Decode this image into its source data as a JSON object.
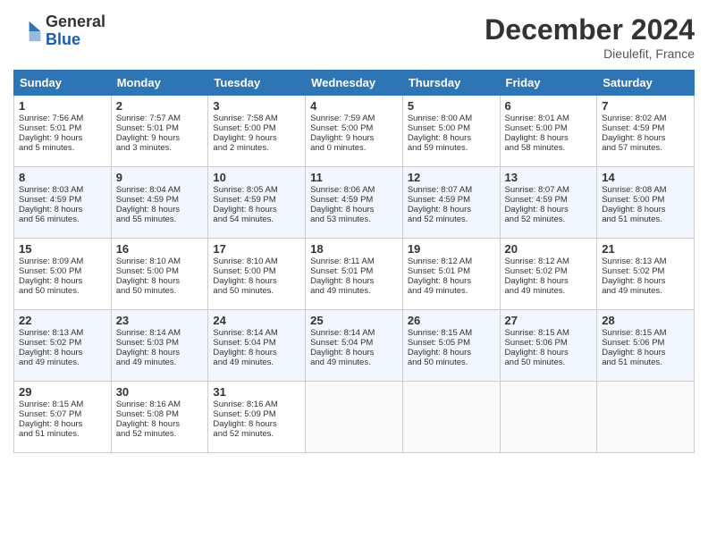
{
  "logo": {
    "line1": "General",
    "line2": "Blue"
  },
  "title": "December 2024",
  "subtitle": "Dieulefit, France",
  "weekdays": [
    "Sunday",
    "Monday",
    "Tuesday",
    "Wednesday",
    "Thursday",
    "Friday",
    "Saturday"
  ],
  "weeks": [
    [
      {
        "day": "1",
        "lines": [
          "Sunrise: 7:56 AM",
          "Sunset: 5:01 PM",
          "Daylight: 9 hours",
          "and 5 minutes."
        ]
      },
      {
        "day": "2",
        "lines": [
          "Sunrise: 7:57 AM",
          "Sunset: 5:01 PM",
          "Daylight: 9 hours",
          "and 3 minutes."
        ]
      },
      {
        "day": "3",
        "lines": [
          "Sunrise: 7:58 AM",
          "Sunset: 5:00 PM",
          "Daylight: 9 hours",
          "and 2 minutes."
        ]
      },
      {
        "day": "4",
        "lines": [
          "Sunrise: 7:59 AM",
          "Sunset: 5:00 PM",
          "Daylight: 9 hours",
          "and 0 minutes."
        ]
      },
      {
        "day": "5",
        "lines": [
          "Sunrise: 8:00 AM",
          "Sunset: 5:00 PM",
          "Daylight: 8 hours",
          "and 59 minutes."
        ]
      },
      {
        "day": "6",
        "lines": [
          "Sunrise: 8:01 AM",
          "Sunset: 5:00 PM",
          "Daylight: 8 hours",
          "and 58 minutes."
        ]
      },
      {
        "day": "7",
        "lines": [
          "Sunrise: 8:02 AM",
          "Sunset: 4:59 PM",
          "Daylight: 8 hours",
          "and 57 minutes."
        ]
      }
    ],
    [
      {
        "day": "8",
        "lines": [
          "Sunrise: 8:03 AM",
          "Sunset: 4:59 PM",
          "Daylight: 8 hours",
          "and 56 minutes."
        ]
      },
      {
        "day": "9",
        "lines": [
          "Sunrise: 8:04 AM",
          "Sunset: 4:59 PM",
          "Daylight: 8 hours",
          "and 55 minutes."
        ]
      },
      {
        "day": "10",
        "lines": [
          "Sunrise: 8:05 AM",
          "Sunset: 4:59 PM",
          "Daylight: 8 hours",
          "and 54 minutes."
        ]
      },
      {
        "day": "11",
        "lines": [
          "Sunrise: 8:06 AM",
          "Sunset: 4:59 PM",
          "Daylight: 8 hours",
          "and 53 minutes."
        ]
      },
      {
        "day": "12",
        "lines": [
          "Sunrise: 8:07 AM",
          "Sunset: 4:59 PM",
          "Daylight: 8 hours",
          "and 52 minutes."
        ]
      },
      {
        "day": "13",
        "lines": [
          "Sunrise: 8:07 AM",
          "Sunset: 4:59 PM",
          "Daylight: 8 hours",
          "and 52 minutes."
        ]
      },
      {
        "day": "14",
        "lines": [
          "Sunrise: 8:08 AM",
          "Sunset: 5:00 PM",
          "Daylight: 8 hours",
          "and 51 minutes."
        ]
      }
    ],
    [
      {
        "day": "15",
        "lines": [
          "Sunrise: 8:09 AM",
          "Sunset: 5:00 PM",
          "Daylight: 8 hours",
          "and 50 minutes."
        ]
      },
      {
        "day": "16",
        "lines": [
          "Sunrise: 8:10 AM",
          "Sunset: 5:00 PM",
          "Daylight: 8 hours",
          "and 50 minutes."
        ]
      },
      {
        "day": "17",
        "lines": [
          "Sunrise: 8:10 AM",
          "Sunset: 5:00 PM",
          "Daylight: 8 hours",
          "and 50 minutes."
        ]
      },
      {
        "day": "18",
        "lines": [
          "Sunrise: 8:11 AM",
          "Sunset: 5:01 PM",
          "Daylight: 8 hours",
          "and 49 minutes."
        ]
      },
      {
        "day": "19",
        "lines": [
          "Sunrise: 8:12 AM",
          "Sunset: 5:01 PM",
          "Daylight: 8 hours",
          "and 49 minutes."
        ]
      },
      {
        "day": "20",
        "lines": [
          "Sunrise: 8:12 AM",
          "Sunset: 5:02 PM",
          "Daylight: 8 hours",
          "and 49 minutes."
        ]
      },
      {
        "day": "21",
        "lines": [
          "Sunrise: 8:13 AM",
          "Sunset: 5:02 PM",
          "Daylight: 8 hours",
          "and 49 minutes."
        ]
      }
    ],
    [
      {
        "day": "22",
        "lines": [
          "Sunrise: 8:13 AM",
          "Sunset: 5:02 PM",
          "Daylight: 8 hours",
          "and 49 minutes."
        ]
      },
      {
        "day": "23",
        "lines": [
          "Sunrise: 8:14 AM",
          "Sunset: 5:03 PM",
          "Daylight: 8 hours",
          "and 49 minutes."
        ]
      },
      {
        "day": "24",
        "lines": [
          "Sunrise: 8:14 AM",
          "Sunset: 5:04 PM",
          "Daylight: 8 hours",
          "and 49 minutes."
        ]
      },
      {
        "day": "25",
        "lines": [
          "Sunrise: 8:14 AM",
          "Sunset: 5:04 PM",
          "Daylight: 8 hours",
          "and 49 minutes."
        ]
      },
      {
        "day": "26",
        "lines": [
          "Sunrise: 8:15 AM",
          "Sunset: 5:05 PM",
          "Daylight: 8 hours",
          "and 50 minutes."
        ]
      },
      {
        "day": "27",
        "lines": [
          "Sunrise: 8:15 AM",
          "Sunset: 5:06 PM",
          "Daylight: 8 hours",
          "and 50 minutes."
        ]
      },
      {
        "day": "28",
        "lines": [
          "Sunrise: 8:15 AM",
          "Sunset: 5:06 PM",
          "Daylight: 8 hours",
          "and 51 minutes."
        ]
      }
    ],
    [
      {
        "day": "29",
        "lines": [
          "Sunrise: 8:15 AM",
          "Sunset: 5:07 PM",
          "Daylight: 8 hours",
          "and 51 minutes."
        ]
      },
      {
        "day": "30",
        "lines": [
          "Sunrise: 8:16 AM",
          "Sunset: 5:08 PM",
          "Daylight: 8 hours",
          "and 52 minutes."
        ]
      },
      {
        "day": "31",
        "lines": [
          "Sunrise: 8:16 AM",
          "Sunset: 5:09 PM",
          "Daylight: 8 hours",
          "and 52 minutes."
        ]
      },
      null,
      null,
      null,
      null
    ]
  ]
}
